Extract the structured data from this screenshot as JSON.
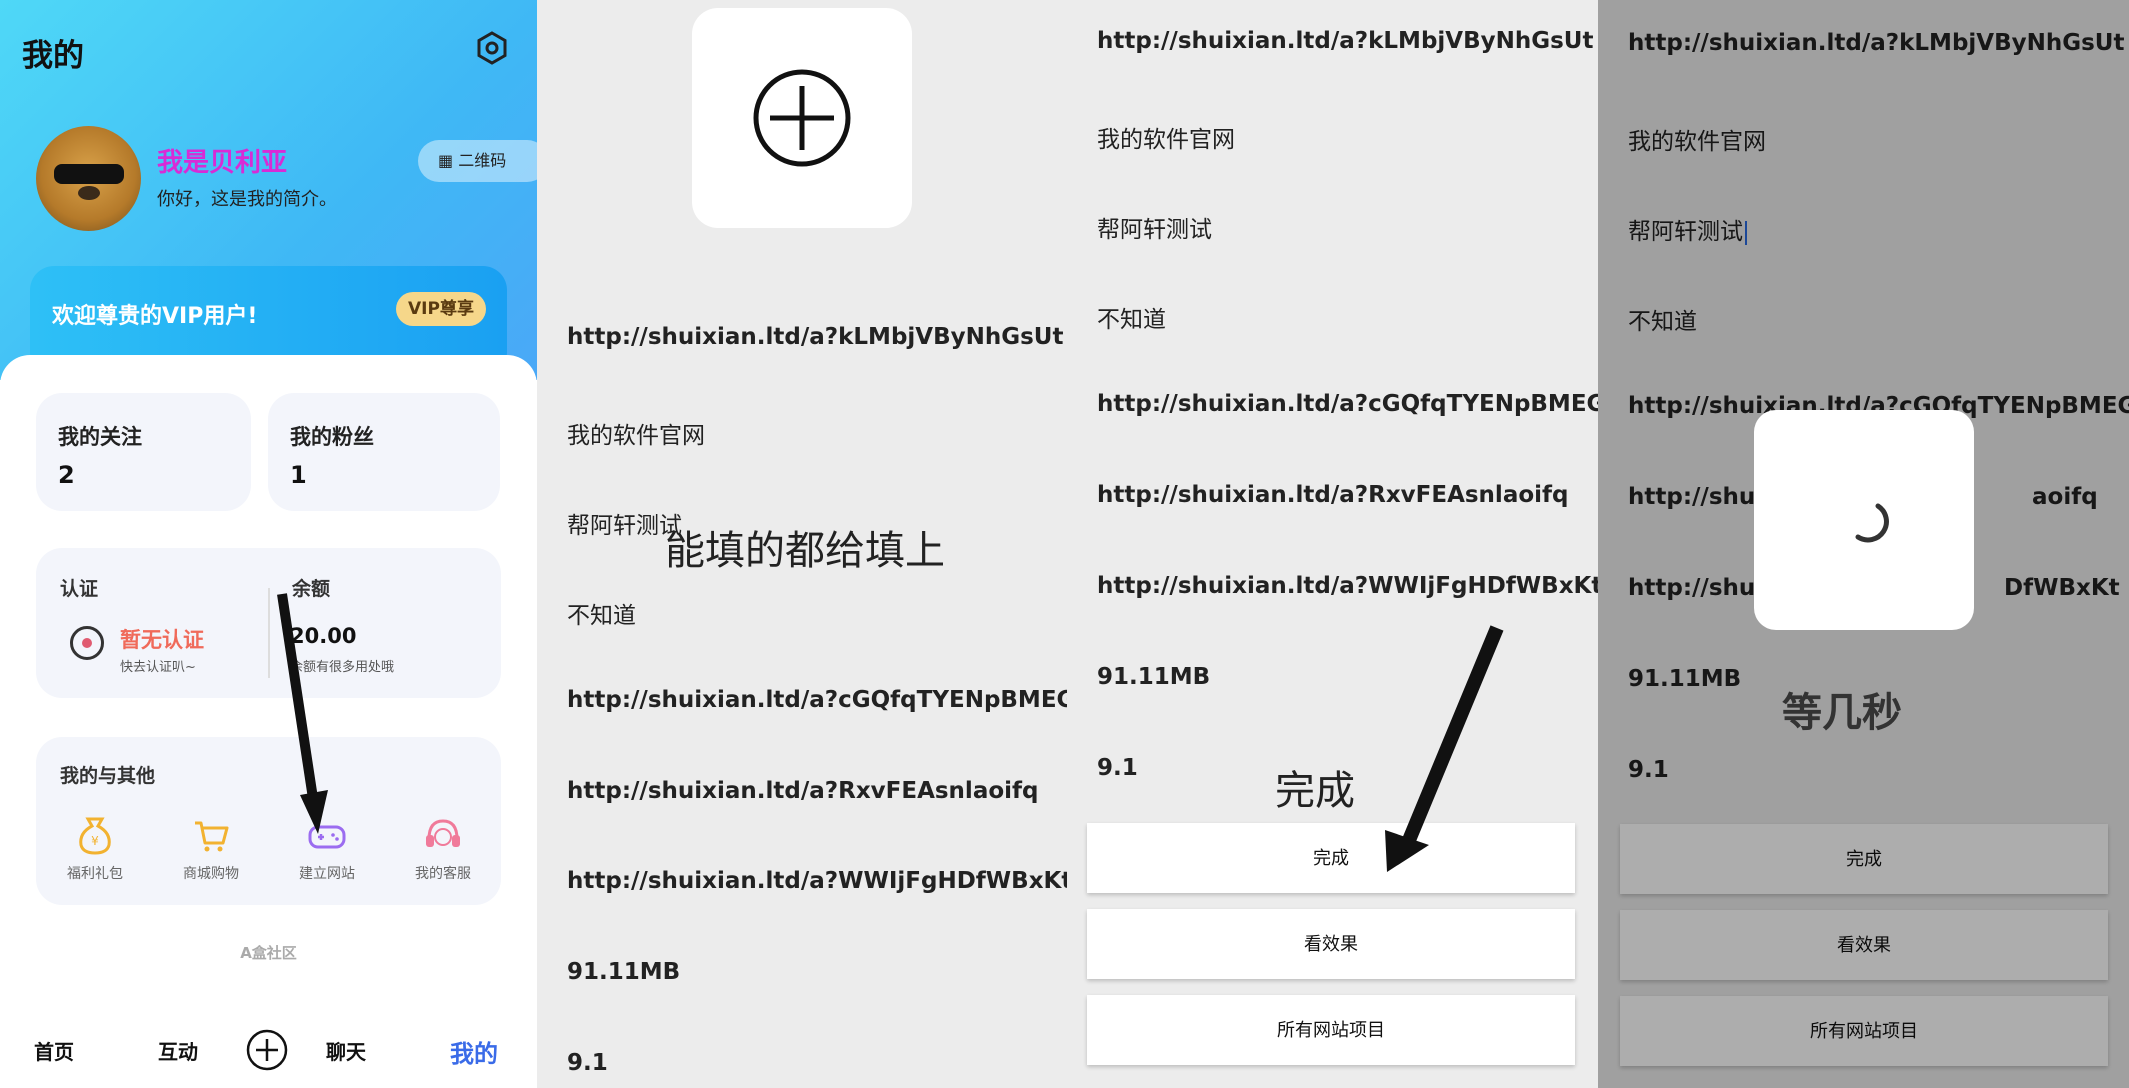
{
  "panel1": {
    "title": "我的",
    "user": {
      "name": "我是贝利亚",
      "bio": "你好，这是我的简介。"
    },
    "qr_button": "▦ 二维码",
    "vip": {
      "welcome": "欢迎尊贵的VIP用户!",
      "badge": "VIP尊享"
    },
    "stats": [
      {
        "label": "我的关注",
        "value": "2"
      },
      {
        "label": "我的粉丝",
        "value": "1"
      }
    ],
    "auth": {
      "label": "认证",
      "status": "暂无认证",
      "sub": "快去认证叭~"
    },
    "balance": {
      "label": "余额",
      "value": "20.00",
      "sub": "余额有很多用处哦"
    },
    "others": {
      "title": "我的与其他",
      "items": [
        {
          "label": "福利礼包",
          "icon": "money-bag-icon",
          "color": "#f2b230"
        },
        {
          "label": "商城购物",
          "icon": "cart-icon",
          "color": "#f2b230"
        },
        {
          "label": "建立网站",
          "icon": "gamepad-icon",
          "color": "#9b6cf0"
        },
        {
          "label": "我的客服",
          "icon": "headset-icon",
          "color": "#f07a9a"
        }
      ]
    },
    "brand": "A盒社区",
    "tabs": {
      "home": "首页",
      "interact": "互动",
      "chat": "聊天",
      "mine": "我的"
    },
    "accent": "#3a6be8"
  },
  "panel2": {
    "items": [
      "http://shuixian.ltd/a?kLMbjVByNhGsUt",
      "我的软件官网",
      "帮阿轩测试",
      "不知道",
      "http://shuixian.ltd/a?cGQfqTYENpBMEG",
      "http://shuixian.ltd/a?RxvFEAsnlaoifq",
      "http://shuixian.ltd/a?WWIjFgHDfWBxKt",
      "91.11MB",
      "9.1"
    ],
    "annotation": "能填的都给填上"
  },
  "panel3": {
    "items": [
      "http://shuixian.ltd/a?kLMbjVByNhGsUt",
      "我的软件官网",
      "帮阿轩测试",
      "不知道",
      "http://shuixian.ltd/a?cGQfqTYENpBMEG",
      "http://shuixian.ltd/a?RxvFEAsnlaoifq",
      "http://shuixian.ltd/a?WWIjFgHDfWBxKt",
      "91.11MB",
      "9.1"
    ],
    "annotation": "完成",
    "buttons": {
      "done": "完成",
      "preview": "看效果",
      "all_projects": "所有网站项目"
    }
  },
  "panel4": {
    "items": [
      "http://shuixian.ltd/a?kLMbjVByNhGsUt",
      "我的软件官网",
      "帮阿轩测试",
      "不知道",
      "http://shuixian.ltd/a?cGQfqTYENpBMEG",
      "http://shuix",
      "aoifq",
      "http://shuix",
      "DfWBxKt",
      "91.11MB",
      "9.1"
    ],
    "annotation": "等几秒",
    "buttons": {
      "done": "完成",
      "preview": "看效果",
      "all_projects": "所有网站项目"
    }
  }
}
